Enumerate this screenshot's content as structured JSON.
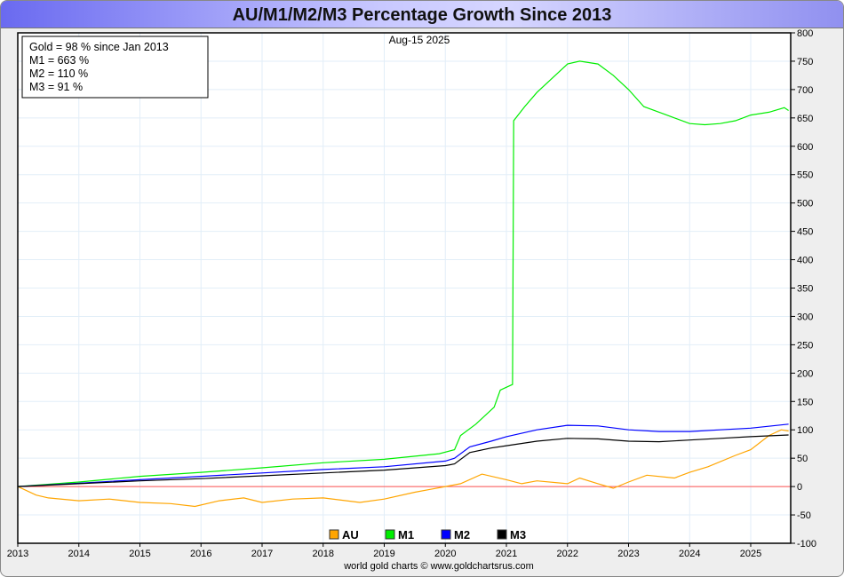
{
  "chart_data": {
    "type": "line",
    "title": "AU/M1/M2/M3 Percentage Growth Since 2013",
    "subtitle": "Aug-15  2025",
    "info_lines": [
      "Gold = 98 % since Jan 2013",
      "M1 = 663 %",
      "M2 = 110 %",
      "M3 = 91 %"
    ],
    "credit": "world gold charts © www.goldchartsrus.com",
    "xlim": [
      2013,
      2025.65
    ],
    "ylim": [
      -100,
      800
    ],
    "x_ticks": [
      "2013",
      "2014",
      "2015",
      "2016",
      "2017",
      "2018",
      "2019",
      "2020",
      "2021",
      "2022",
      "2023",
      "2024",
      "2025"
    ],
    "y_ticks": [
      -100,
      -50,
      0,
      50,
      100,
      150,
      200,
      250,
      300,
      350,
      400,
      450,
      500,
      550,
      600,
      650,
      700,
      750,
      800
    ],
    "grid": true,
    "legend_position": "bottom-center",
    "series": [
      {
        "name": "AU",
        "color": "#ffa500",
        "points": [
          [
            2013,
            0
          ],
          [
            2013.3,
            -15
          ],
          [
            2013.5,
            -20
          ],
          [
            2014,
            -25
          ],
          [
            2014.5,
            -22
          ],
          [
            2015,
            -28
          ],
          [
            2015.5,
            -30
          ],
          [
            2015.9,
            -35
          ],
          [
            2016.3,
            -25
          ],
          [
            2016.7,
            -20
          ],
          [
            2017,
            -28
          ],
          [
            2017.5,
            -22
          ],
          [
            2018,
            -20
          ],
          [
            2018.6,
            -28
          ],
          [
            2019,
            -22
          ],
          [
            2019.5,
            -10
          ],
          [
            2019.75,
            -5
          ],
          [
            2020,
            0
          ],
          [
            2020.25,
            5
          ],
          [
            2020.6,
            22
          ],
          [
            2021,
            12
          ],
          [
            2021.25,
            5
          ],
          [
            2021.5,
            10
          ],
          [
            2022,
            5
          ],
          [
            2022.2,
            15
          ],
          [
            2022.5,
            5
          ],
          [
            2022.75,
            -3
          ],
          [
            2023,
            8
          ],
          [
            2023.3,
            20
          ],
          [
            2023.75,
            15
          ],
          [
            2024,
            25
          ],
          [
            2024.3,
            35
          ],
          [
            2024.75,
            55
          ],
          [
            2025,
            65
          ],
          [
            2025.3,
            90
          ],
          [
            2025.5,
            100
          ],
          [
            2025.62,
            98
          ]
        ]
      },
      {
        "name": "M1",
        "color": "#00ee00",
        "points": [
          [
            2013,
            0
          ],
          [
            2014,
            8
          ],
          [
            2015,
            18
          ],
          [
            2016,
            25
          ],
          [
            2017,
            33
          ],
          [
            2018,
            42
          ],
          [
            2019,
            48
          ],
          [
            2019.9,
            58
          ],
          [
            2020.15,
            65
          ],
          [
            2020.25,
            90
          ],
          [
            2020.5,
            110
          ],
          [
            2020.8,
            140
          ],
          [
            2020.9,
            170
          ],
          [
            2021.1,
            180
          ],
          [
            2021.12,
            645
          ],
          [
            2021.3,
            670
          ],
          [
            2021.5,
            695
          ],
          [
            2021.75,
            720
          ],
          [
            2022,
            745
          ],
          [
            2022.2,
            750
          ],
          [
            2022.5,
            745
          ],
          [
            2022.75,
            725
          ],
          [
            2023,
            700
          ],
          [
            2023.25,
            670
          ],
          [
            2023.5,
            660
          ],
          [
            2023.75,
            650
          ],
          [
            2024,
            640
          ],
          [
            2024.25,
            638
          ],
          [
            2024.5,
            640
          ],
          [
            2024.75,
            645
          ],
          [
            2025,
            655
          ],
          [
            2025.3,
            660
          ],
          [
            2025.55,
            668
          ],
          [
            2025.62,
            663
          ]
        ]
      },
      {
        "name": "M2",
        "color": "#0000ff",
        "points": [
          [
            2013,
            0
          ],
          [
            2014,
            6
          ],
          [
            2015,
            12
          ],
          [
            2016,
            18
          ],
          [
            2017,
            24
          ],
          [
            2018,
            30
          ],
          [
            2019,
            35
          ],
          [
            2020,
            45
          ],
          [
            2020.15,
            50
          ],
          [
            2020.4,
            70
          ],
          [
            2020.75,
            80
          ],
          [
            2021,
            88
          ],
          [
            2021.5,
            100
          ],
          [
            2022,
            108
          ],
          [
            2022.5,
            107
          ],
          [
            2023,
            100
          ],
          [
            2023.5,
            97
          ],
          [
            2024,
            97
          ],
          [
            2024.5,
            100
          ],
          [
            2025,
            103
          ],
          [
            2025.62,
            110
          ]
        ]
      },
      {
        "name": "M3",
        "color": "#000000",
        "points": [
          [
            2013,
            0
          ],
          [
            2014,
            5
          ],
          [
            2015,
            10
          ],
          [
            2016,
            14
          ],
          [
            2017,
            19
          ],
          [
            2018,
            24
          ],
          [
            2019,
            29
          ],
          [
            2020,
            37
          ],
          [
            2020.15,
            40
          ],
          [
            2020.4,
            60
          ],
          [
            2020.75,
            68
          ],
          [
            2021,
            72
          ],
          [
            2021.5,
            80
          ],
          [
            2022,
            85
          ],
          [
            2022.5,
            84
          ],
          [
            2023,
            80
          ],
          [
            2023.5,
            79
          ],
          [
            2024,
            82
          ],
          [
            2024.5,
            85
          ],
          [
            2025,
            88
          ],
          [
            2025.62,
            91
          ]
        ]
      }
    ]
  }
}
